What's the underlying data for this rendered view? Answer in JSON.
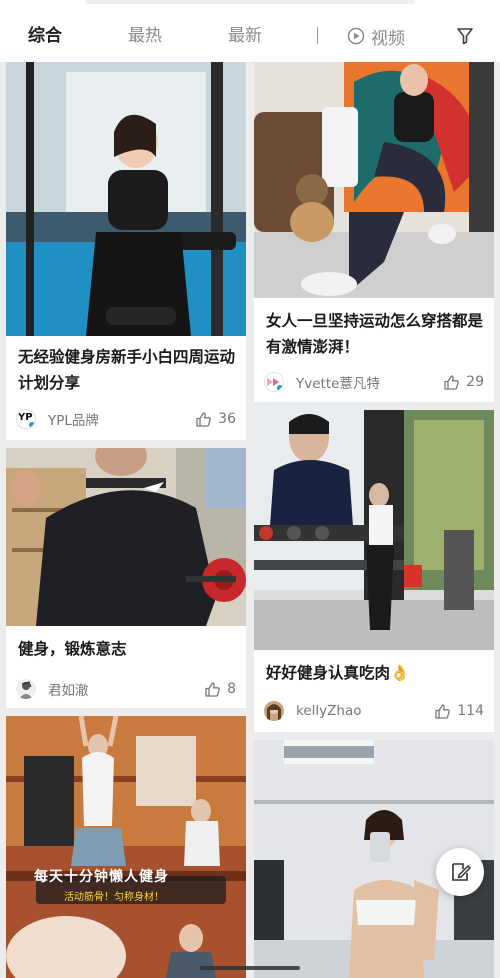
{
  "tabs": [
    "综合",
    "最热",
    "最新"
  ],
  "video_tab": "视频",
  "cards": [
    {
      "title": "无经验健身房新手小白四周运动计划分享",
      "author": "YPL品牌",
      "avatar_text": "YP",
      "likes": "36"
    },
    {
      "title": "女人一旦坚持运动怎么穿搭都是有激情澎湃！",
      "author": "Yvette薏凡特",
      "likes": "29"
    },
    {
      "title": "健身，锻炼意志",
      "author": "君如澈",
      "likes": "8"
    },
    {
      "title": "好好健身认真吃肉👌",
      "author": "kellyZhao",
      "likes": "114"
    },
    {
      "title": "",
      "author": "",
      "likes": ""
    },
    {
      "title": "",
      "author": "",
      "likes": ""
    }
  ],
  "card5_overlay": {
    "headline": "每天十分钟懒人健身",
    "sub": "活动筋骨！匀称身材！"
  },
  "colors": {
    "accent_blue": "#1a9bd8",
    "text_dark": "#1a1a1a",
    "text_gray": "#777777"
  },
  "icons": [
    "video-play-icon",
    "filter-icon",
    "thumbs-up-icon",
    "edit-note-icon"
  ]
}
